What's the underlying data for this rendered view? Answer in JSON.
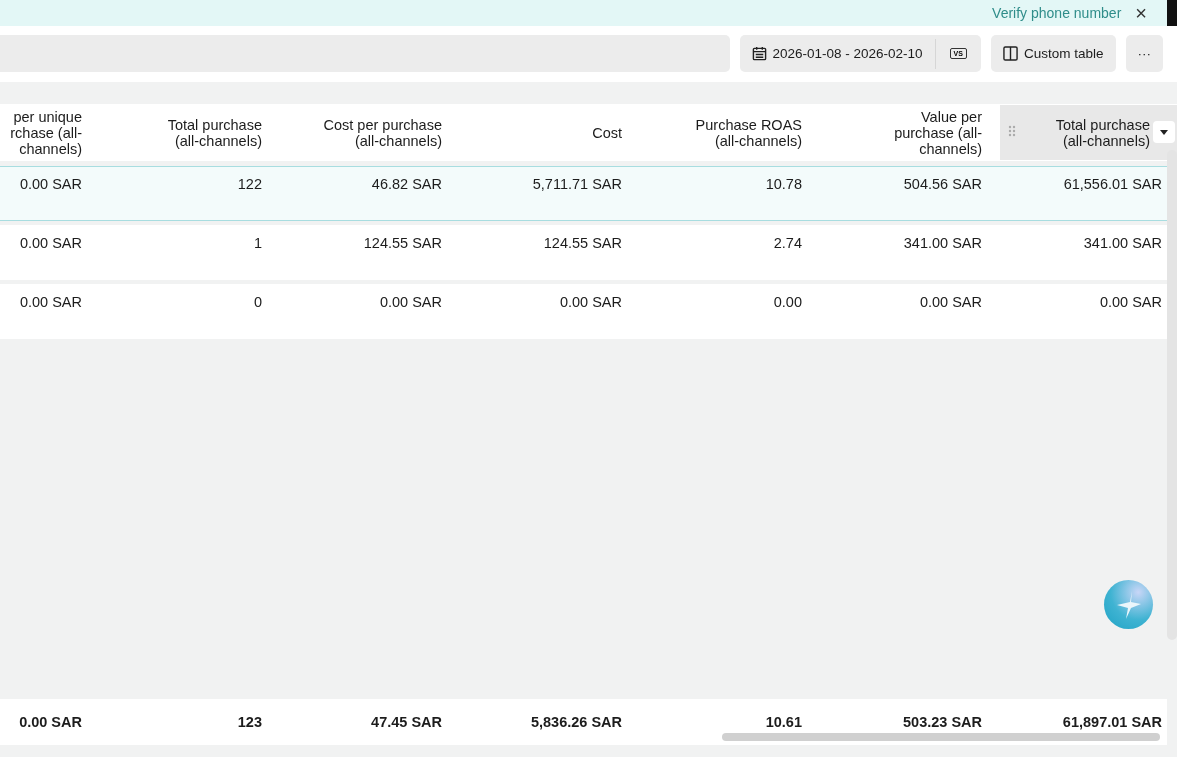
{
  "banner": {
    "link": "Verify phone number",
    "close": "×"
  },
  "toolbar": {
    "date_range": "2026-01-08 - 2026-02-10",
    "compare": "VS",
    "custom_table": "Custom table",
    "more": "···"
  },
  "table": {
    "columns": [
      {
        "label": "per unique\nrchase (all-\nchannels)",
        "active": false
      },
      {
        "label": "Total purchase\n(all-channels)",
        "active": false
      },
      {
        "label": "Cost per purchase\n(all-channels)",
        "active": false
      },
      {
        "label": "Cost",
        "active": false
      },
      {
        "label": "Purchase ROAS\n(all-channels)",
        "active": false
      },
      {
        "label": "Value per\npurchase (all-\nchannels)",
        "active": false
      },
      {
        "label": "Total purchase\n(all-channels)",
        "active": true
      }
    ],
    "rows": [
      {
        "selected": true,
        "cells": [
          "0.00 SAR",
          "122",
          "46.82 SAR",
          "5,711.71 SAR",
          "10.78",
          "504.56 SAR",
          "61,556.01 SAR"
        ]
      },
      {
        "selected": false,
        "cells": [
          "0.00 SAR",
          "1",
          "124.55 SAR",
          "124.55 SAR",
          "2.74",
          "341.00 SAR",
          "341.00 SAR"
        ]
      },
      {
        "selected": false,
        "cells": [
          "0.00 SAR",
          "0",
          "0.00 SAR",
          "0.00 SAR",
          "0.00",
          "0.00 SAR",
          "0.00 SAR"
        ]
      }
    ],
    "total": [
      "0.00 SAR",
      "123",
      "47.45 SAR",
      "5,836.26 SAR",
      "10.61",
      "503.23 SAR",
      "61,897.01 SAR"
    ]
  }
}
